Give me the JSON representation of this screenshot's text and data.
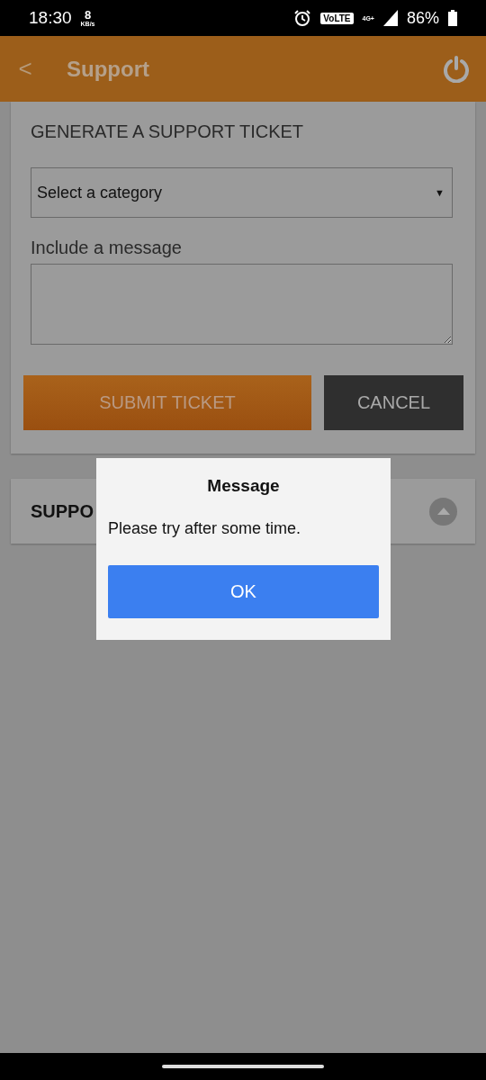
{
  "status_bar": {
    "time": "18:30",
    "speed_value": "8",
    "speed_unit": "KB/s",
    "volte": "VoLTE",
    "network": "4G+",
    "battery": "86%"
  },
  "header": {
    "back": "<",
    "title": "Support"
  },
  "ticket_form": {
    "heading": "GENERATE A SUPPORT TICKET",
    "category": {
      "value": "Select a category",
      "caret": "▼"
    },
    "message_label": "Include a message",
    "submit": "SUBMIT TICKET",
    "cancel": "CANCEL"
  },
  "history": {
    "title": "SUPPO",
    "expanded": true
  },
  "dialog": {
    "title": "Message",
    "text": "Please try after some time.",
    "ok": "OK"
  }
}
